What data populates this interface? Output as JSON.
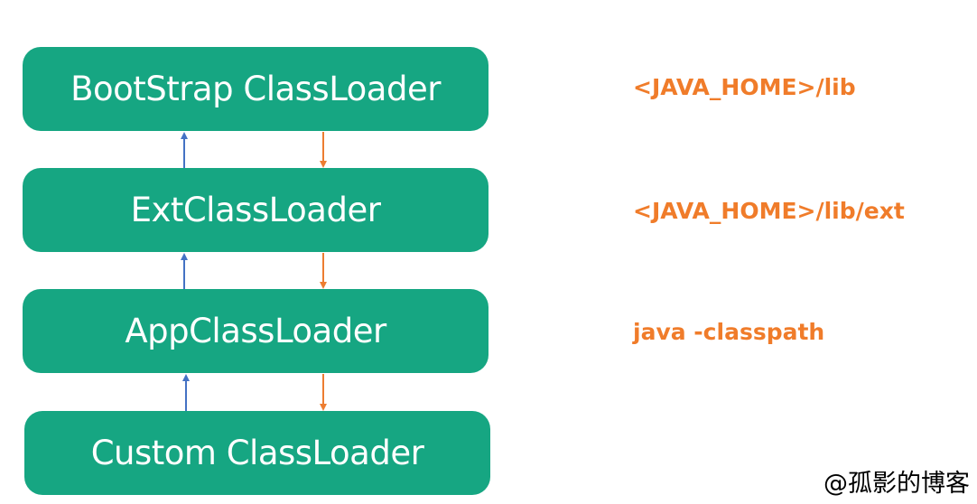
{
  "loaders": [
    {
      "label": "BootStrap ClassLoader"
    },
    {
      "label": "ExtClassLoader"
    },
    {
      "label": "AppClassLoader"
    },
    {
      "label": "Custom ClassLoader"
    }
  ],
  "paths": [
    {
      "label": "<JAVA_HOME>/lib"
    },
    {
      "label": "<JAVA_HOME>/lib/ext"
    },
    {
      "label": "java -classpath"
    }
  ],
  "watermark": "@孤影的博客",
  "colors": {
    "box_fill": "#16a682",
    "box_text": "#ffffff",
    "path_text": "#f07c2a",
    "up_arrow": "#4472c4",
    "down_arrow": "#ed7d31"
  }
}
